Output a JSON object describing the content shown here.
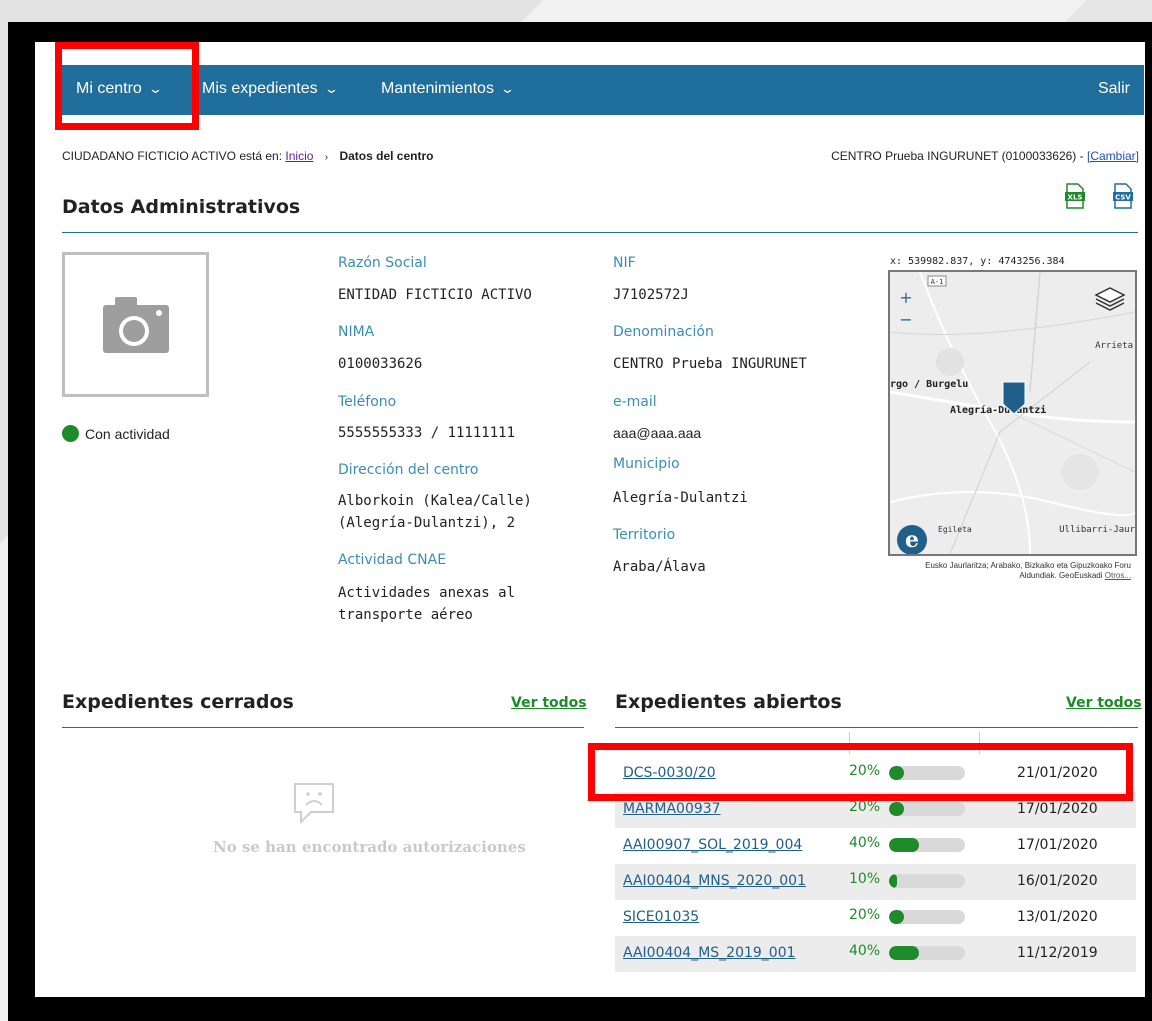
{
  "nav": {
    "items": [
      {
        "label": "Mi centro"
      },
      {
        "label": "Mis expedientes"
      },
      {
        "label": "Mantenimientos"
      }
    ],
    "logout": "Salir"
  },
  "breadcrumb": {
    "user_prefix": "CIUDADANO FICTICIO ACTIVO está en:",
    "home": "Inicio",
    "current": "Datos del centro",
    "center_text": "CENTRO Prueba INGURUNET (0100033626) -",
    "change_link": "[Cambiar]"
  },
  "section_title": "Datos Administrativos",
  "exports": [
    "XLS",
    "CSV"
  ],
  "status": "Con actividad",
  "fields": {
    "razon_social_label": "Razón Social",
    "razon_social": "ENTIDAD FICTICIO ACTIVO",
    "nima_label": "NIMA",
    "nima": "0100033626",
    "telefono_label": "Teléfono",
    "telefono": "5555555333 / 11111111",
    "direccion_label": "Dirección del centro",
    "direccion_line1": "Alborkoin (Kalea/Calle)",
    "direccion_line2": "(Alegría-Dulantzi), 2",
    "cnae_label": "Actividad CNAE",
    "cnae_line1": "Actividades anexas al",
    "cnae_line2": "transporte aéreo",
    "nif_label": "NIF",
    "nif": "J7102572J",
    "denominacion_label": "Denominación",
    "denominacion": "CENTRO Prueba INGURUNET",
    "email_label": "e-mail",
    "email": "aaa@aaa.aaa",
    "municipio_label": "Municipio",
    "municipio": "Alegría-Dulantzi",
    "territorio_label": "Territorio",
    "territorio": "Araba/Álava"
  },
  "map": {
    "coords": "x: 539982.837, y: 4743256.384",
    "road_label": "A-1",
    "zoom_in": "+",
    "zoom_out": "−",
    "places": [
      "Arrieta",
      "rgo / Burgelu",
      "Alegría-Dulantzi",
      "Egileta",
      "Ullibarri-Jaur"
    ],
    "attribution": "Eusko Jaurlaritza; Arabako, Bizkaiko eta Gipuzkoako Foru Aldundiak. GeoEuskadi",
    "attribution_link": "Otros..."
  },
  "closed": {
    "title": "Expedientes cerrados",
    "view_all": "Ver todos",
    "empty_message": "No se han encontrado autorizaciones"
  },
  "open": {
    "title": "Expedientes abiertos",
    "view_all": "Ver todos",
    "rows": [
      {
        "code": "DCS-0030/20",
        "pct": "20%",
        "progress": 0.2,
        "date": "21/01/2020"
      },
      {
        "code": "MARMA00937",
        "pct": "20%",
        "progress": 0.2,
        "date": "17/01/2020"
      },
      {
        "code": "AAI00907_SOL_2019_004",
        "pct": "40%",
        "progress": 0.4,
        "date": "17/01/2020"
      },
      {
        "code": "AAI00404_MNS_2020_001",
        "pct": "10%",
        "progress": 0.1,
        "date": "16/01/2020"
      },
      {
        "code": "SICE01035",
        "pct": "20%",
        "progress": 0.2,
        "date": "13/01/2020"
      },
      {
        "code": "AAI00404_MS_2019_001",
        "pct": "40%",
        "progress": 0.4,
        "date": "11/12/2019"
      }
    ]
  },
  "colors": {
    "nav_bg": "#1f6e9c",
    "highlight": "#ff0000",
    "label_blue": "#3a8cb8",
    "progress_green": "#1f8a2a"
  }
}
